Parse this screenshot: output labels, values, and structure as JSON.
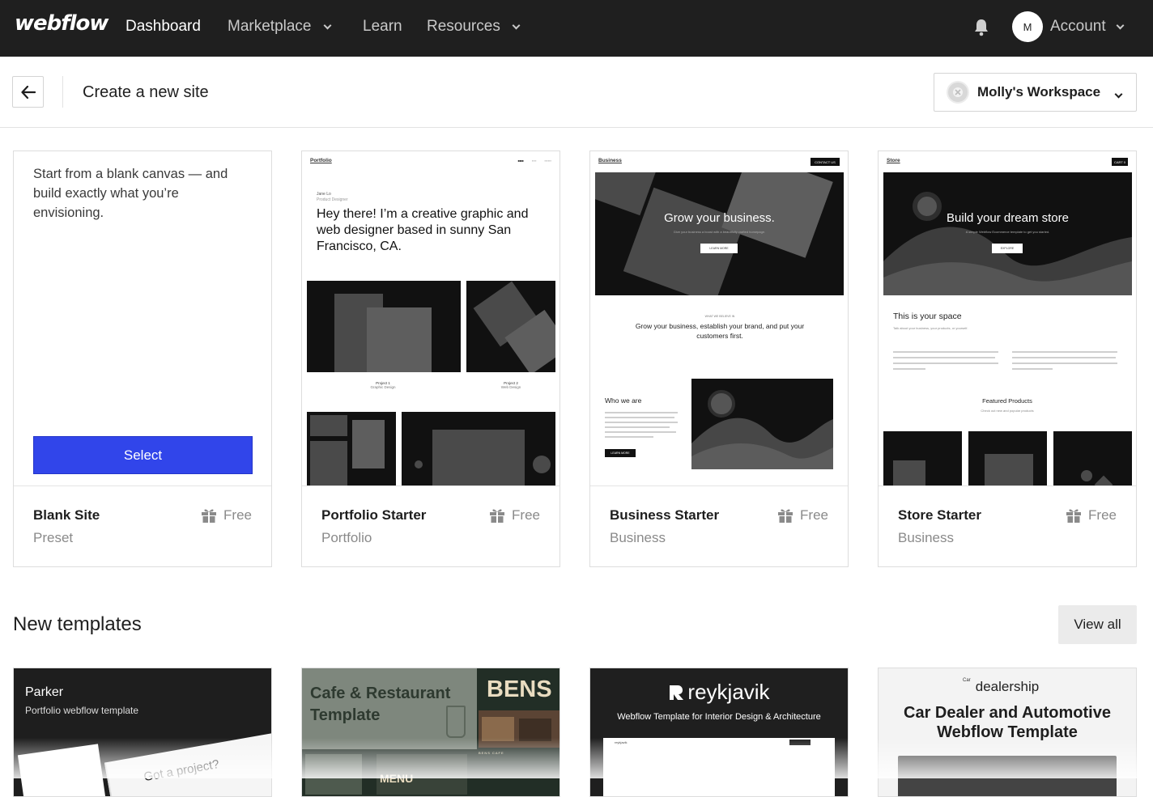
{
  "topnav": {
    "logo": "webflow",
    "items": [
      {
        "label": "Dashboard",
        "has_dropdown": false,
        "active": true
      },
      {
        "label": "Marketplace",
        "has_dropdown": true,
        "active": false
      },
      {
        "label": "Learn",
        "has_dropdown": false,
        "active": false
      },
      {
        "label": "Resources",
        "has_dropdown": true,
        "active": false
      }
    ],
    "notifications_icon": "bell-icon",
    "avatar_initial": "M",
    "account_label": "Account"
  },
  "subheader": {
    "back_icon": "arrow-left-icon",
    "title": "Create a new site",
    "workspace_label": "Molly's Workspace"
  },
  "starters": [
    {
      "name": "Blank Site",
      "category": "Preset",
      "price": "Free",
      "description": "Start from a blank canvas — and build exactly what you’re envisioning.",
      "select_label": "Select"
    },
    {
      "name": "Portfolio Starter",
      "category": "Portfolio",
      "price": "Free",
      "preview": {
        "brand": "Portfolio",
        "author": "Jane Lo",
        "role": "Product Designer",
        "headline": "Hey there! I’m a creative graphic and web designer based in sunny San Francisco, CA.",
        "project1": "Project 1",
        "project1_sub": "Graphic Design",
        "project2": "Project 2",
        "project2_sub": "Web Design"
      }
    },
    {
      "name": "Business Starter",
      "category": "Business",
      "price": "Free",
      "preview": {
        "brand": "Business",
        "cta": "CONTACT US",
        "hero": "Grow your business.",
        "hero_sub": "Give your business a boost with a beautifully crafted homepage.",
        "hero_btn": "LEARN MORE",
        "kicker": "WHAT WE BELIEVE IN",
        "tagline": "Grow your business, establish your brand, and put your customers first.",
        "who": "Who we are",
        "who_btn": "LEARN MORE"
      }
    },
    {
      "name": "Store Starter",
      "category": "Business",
      "price": "Free",
      "preview": {
        "brand": "Store",
        "cta": "CART 0",
        "hero": "Build your dream store",
        "hero_sub": "A simple Webflow Ecommerce template to get you started.",
        "hero_btn": "EXPLORE",
        "space": "This is your space",
        "space_sub": "Talk about your business, your products, or yourself.",
        "featured": "Featured Products",
        "featured_sub": "Check out new and popular products"
      }
    }
  ],
  "new_templates": {
    "title": "New templates",
    "view_all_label": "View all",
    "items": [
      {
        "title": "Parker",
        "subtitle": "Portfolio webflow template",
        "teaser": "Got a project?"
      },
      {
        "title": "Cafe & Restaurant Template",
        "brand": "BENS",
        "menu": "MENU",
        "tag": "BENS CAFE"
      },
      {
        "title": "reykjavik",
        "subtitle": "Webflow Template for Interior Design & Architecture",
        "nav_brand": "reykjavik"
      },
      {
        "title": "dealership",
        "prefix": "Car",
        "subtitle": "Car Dealer and Automotive Webflow Template"
      }
    ]
  }
}
